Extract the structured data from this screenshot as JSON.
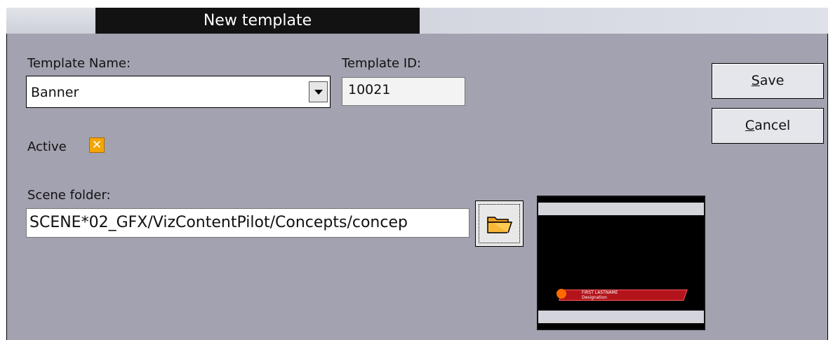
{
  "titlebar": {
    "title": "New template"
  },
  "form": {
    "template_name_label": "Template Name:",
    "template_name_value": "Banner",
    "template_id_label": "Template ID:",
    "template_id_value": "10021",
    "active_label": "Active",
    "active_checked": true,
    "scene_folder_label": "Scene folder:",
    "scene_folder_value": "SCENE*02_GFX/VizContentPilot/Concepts/concep"
  },
  "buttons": {
    "save_mnemonic": "S",
    "save_rest": "ave",
    "cancel_mnemonic": "C",
    "cancel_rest": "ancel"
  },
  "preview": {
    "lower_third_line1": "FIRST LASTNAME",
    "lower_third_line2": "Designation"
  },
  "colors": {
    "panel": "#a3a2b0",
    "active_tab": "#121212",
    "checkbox": "#f4a500",
    "lower_third": "#b3141b"
  },
  "icons": [
    "dropdown-arrow-icon",
    "checkbox-x-icon",
    "folder-open-icon"
  ]
}
